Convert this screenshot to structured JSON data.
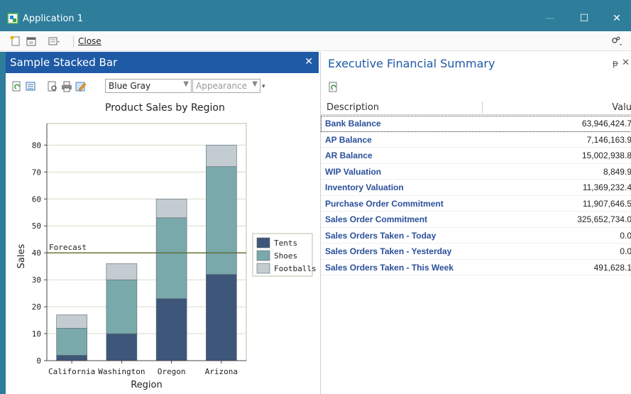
{
  "window": {
    "title": "Application 1",
    "min_glyph": "—",
    "max_glyph": "☐",
    "close_glyph": "✕"
  },
  "toolbar": {
    "close_label": "Close"
  },
  "left_panel": {
    "title": "Sample Stacked Bar",
    "close_glyph": "✕",
    "theme_combo": "Blue Gray",
    "appearance_combo": "Appearance"
  },
  "chart_data": {
    "type": "bar",
    "stacked": true,
    "title": "Product Sales by Region",
    "xlabel": "Region",
    "ylabel": "Sales",
    "ylim": [
      0,
      88
    ],
    "yticks": [
      0,
      10,
      20,
      30,
      40,
      50,
      60,
      70,
      80
    ],
    "categories": [
      "California",
      "Washington",
      "Oregon",
      "Arizona"
    ],
    "series": [
      {
        "name": "Tents",
        "values": [
          2,
          10,
          23,
          32
        ],
        "color": "#3e5679"
      },
      {
        "name": "Shoes",
        "values": [
          10,
          20,
          30,
          40
        ],
        "color": "#7aa9ab"
      },
      {
        "name": "Footballs",
        "values": [
          5,
          6,
          7,
          8
        ],
        "color": "#c3ccd1"
      }
    ],
    "forecast": {
      "label": "Forecast",
      "value": 40,
      "color": "#5a6b2a"
    },
    "legend_position": "right",
    "grid": true
  },
  "right_panel": {
    "title": "Executive Financial Summary",
    "pin_glyph": "ᵽ",
    "close_glyph": "✕",
    "columns": [
      "Description",
      "Valu"
    ],
    "rows": [
      {
        "description": "Bank Balance",
        "value": "63,946,424.7"
      },
      {
        "description": "AP Balance",
        "value": "7,146,163.9"
      },
      {
        "description": "AR Balance",
        "value": "15,002,938.8"
      },
      {
        "description": "WIP Valuation",
        "value": "8,849.9"
      },
      {
        "description": "Inventory Valuation",
        "value": "11,369,232.4"
      },
      {
        "description": "Purchase Order Commitment",
        "value": "11,907,646.5"
      },
      {
        "description": "Sales Order Commitment",
        "value": "325,652,734.0"
      },
      {
        "description": "Sales Orders Taken - Today",
        "value": "0.0"
      },
      {
        "description": "Sales Orders Taken - Yesterday",
        "value": "0.0"
      },
      {
        "description": "Sales Orders Taken - This Week",
        "value": "491,628.1"
      }
    ]
  },
  "colors": {
    "titlebar": "#2e7d9b",
    "panel_header": "#1f5aa6",
    "link_text": "#2a4f9a"
  },
  "icons": [
    "app-icon",
    "new-icon",
    "calendar-icon",
    "layout-icon",
    "settings-icon",
    "refresh-icon",
    "list-icon",
    "preview-icon",
    "print-icon",
    "edit-icon"
  ]
}
